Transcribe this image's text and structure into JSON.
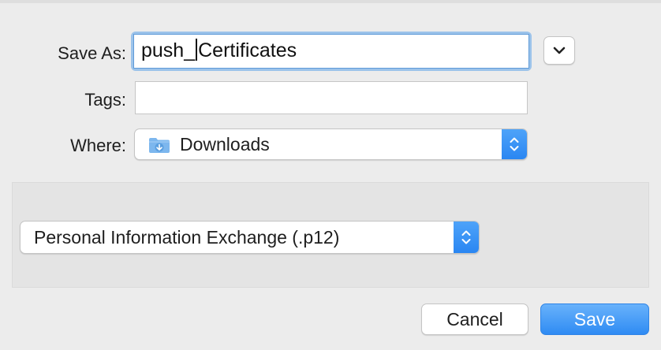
{
  "dialog": {
    "save_as_label": "Save As:",
    "filename_before_caret": "push_",
    "filename_after_caret": "Certificates",
    "tags_label": "Tags:",
    "tags_value": "",
    "where_label": "Where:",
    "where_value": "Downloads",
    "format_value": "Personal Information Exchange (.p12)",
    "cancel_label": "Cancel",
    "save_label": "Save"
  },
  "icons": {
    "expand": "chevron-down-icon",
    "location": "downloads-folder-icon",
    "stepper": "up-down-arrows-icon"
  },
  "colors": {
    "accent": "#2f8bf3",
    "focus_ring": "#9cc3ea",
    "folder": "#7db7ee"
  }
}
